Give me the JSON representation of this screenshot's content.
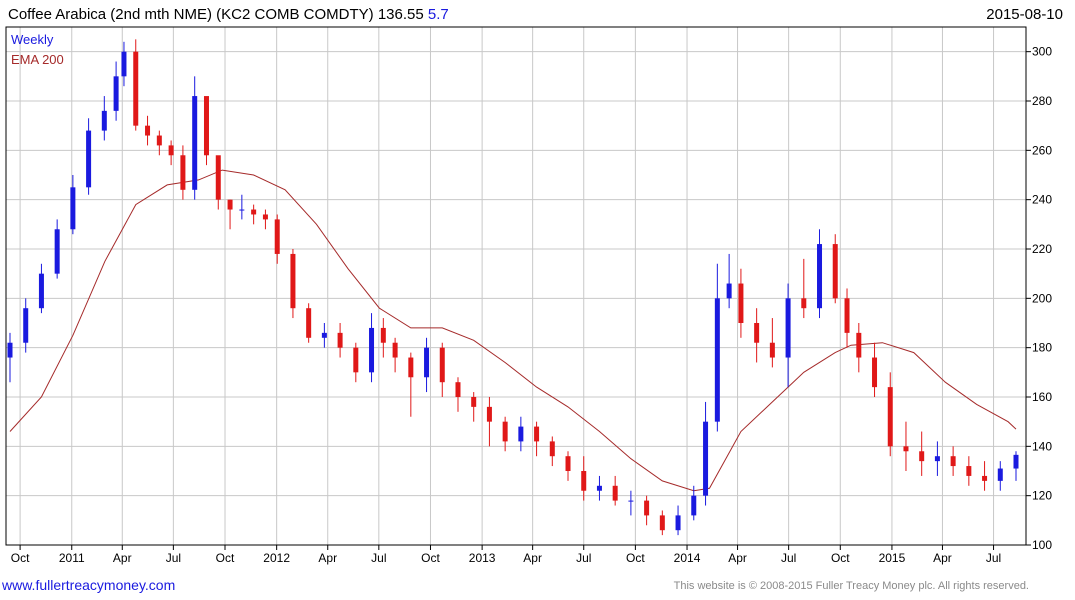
{
  "header": {
    "title": "Coffee Arabica (2nd mth NME) (KC2 COMB COMDTY) 136.55",
    "change": "5.7",
    "date": "2015-08-10"
  },
  "footer": {
    "link": "www.fullertreacymoney.com",
    "copyright": "This website is © 2008-2015 Fuller Treacy Money plc. All rights reserved."
  },
  "colors": {
    "up": "#1a1adf",
    "down": "#e01818",
    "ema": "#a52a2a",
    "grid": "#c8c8c8"
  },
  "chart_data": {
    "type": "line",
    "subtype": "weekly candlestick with moving average",
    "legend": [
      {
        "label": "Weekly",
        "color": "#1a1adf"
      },
      {
        "label": "EMA 200",
        "color": "#a52a2a"
      }
    ],
    "legend_position": "top-left",
    "grid": true,
    "yaxis_side": "right",
    "ylim": [
      100,
      310
    ],
    "yticks": [
      100,
      120,
      140,
      160,
      180,
      200,
      220,
      240,
      260,
      280,
      300
    ],
    "xlim": [
      "2010-09-13",
      "2015-08-10"
    ],
    "xticks": [
      {
        "label": "Oct",
        "date": "2010-10-01"
      },
      {
        "label": "2011",
        "date": "2011-01-01"
      },
      {
        "label": "Apr",
        "date": "2011-04-01"
      },
      {
        "label": "Jul",
        "date": "2011-07-01"
      },
      {
        "label": "Oct",
        "date": "2011-10-01"
      },
      {
        "label": "2012",
        "date": "2012-01-01"
      },
      {
        "label": "Apr",
        "date": "2012-04-01"
      },
      {
        "label": "Jul",
        "date": "2012-07-01"
      },
      {
        "label": "Oct",
        "date": "2012-10-01"
      },
      {
        "label": "2013",
        "date": "2013-01-01"
      },
      {
        "label": "Apr",
        "date": "2013-04-01"
      },
      {
        "label": "Jul",
        "date": "2013-07-01"
      },
      {
        "label": "Oct",
        "date": "2013-10-01"
      },
      {
        "label": "2014",
        "date": "2014-01-01"
      },
      {
        "label": "Apr",
        "date": "2014-04-01"
      },
      {
        "label": "Jul",
        "date": "2014-07-01"
      },
      {
        "label": "Oct",
        "date": "2014-10-01"
      },
      {
        "label": "2015",
        "date": "2015-01-01"
      },
      {
        "label": "Apr",
        "date": "2015-04-01"
      },
      {
        "label": "Jul",
        "date": "2015-07-01"
      }
    ],
    "series": [
      {
        "name": "Weekly",
        "style": "candlestick",
        "x": [
          "2010-09-13",
          "2010-10-11",
          "2010-11-08",
          "2010-12-06",
          "2011-01-03",
          "2011-01-31",
          "2011-02-28",
          "2011-03-21",
          "2011-04-04",
          "2011-04-25",
          "2011-05-16",
          "2011-06-06",
          "2011-06-27",
          "2011-07-18",
          "2011-08-08",
          "2011-08-29",
          "2011-09-19",
          "2011-10-10",
          "2011-10-31",
          "2011-11-21",
          "2011-12-12",
          "2012-01-02",
          "2012-01-30",
          "2012-02-27",
          "2012-03-26",
          "2012-04-23",
          "2012-05-21",
          "2012-06-18",
          "2012-07-09",
          "2012-07-30",
          "2012-08-27",
          "2012-09-24",
          "2012-10-22",
          "2012-11-19",
          "2012-12-17",
          "2013-01-14",
          "2013-02-11",
          "2013-03-11",
          "2013-04-08",
          "2013-05-06",
          "2013-06-03",
          "2013-07-01",
          "2013-07-29",
          "2013-08-26",
          "2013-09-23",
          "2013-10-21",
          "2013-11-18",
          "2013-12-16",
          "2014-01-13",
          "2014-02-03",
          "2014-02-24",
          "2014-03-17",
          "2014-04-07",
          "2014-05-05",
          "2014-06-02",
          "2014-06-30",
          "2014-07-28",
          "2014-08-25",
          "2014-09-22",
          "2014-10-13",
          "2014-11-03",
          "2014-12-01",
          "2014-12-29",
          "2015-01-26",
          "2015-02-23",
          "2015-03-23",
          "2015-04-20",
          "2015-05-18",
          "2015-06-15",
          "2015-07-13",
          "2015-08-10"
        ],
        "open": [
          176,
          182,
          196,
          210,
          228,
          245,
          268,
          276,
          290,
          300,
          270,
          266,
          262,
          258,
          244,
          282,
          258,
          240,
          236,
          236,
          234,
          232,
          218,
          196,
          184,
          186,
          180,
          170,
          188,
          182,
          176,
          168,
          180,
          166,
          160,
          156,
          150,
          142,
          148,
          142,
          136,
          130,
          122,
          124,
          118,
          118,
          112,
          106,
          112,
          120,
          150,
          200,
          206,
          190,
          182,
          176,
          200,
          196,
          222,
          200,
          186,
          176,
          164,
          140,
          138,
          134,
          136,
          132,
          128,
          126,
          131
        ],
        "close": [
          182,
          196,
          210,
          228,
          245,
          268,
          276,
          290,
          300,
          270,
          266,
          262,
          258,
          244,
          282,
          258,
          240,
          236,
          236,
          234,
          232,
          218,
          196,
          184,
          186,
          180,
          170,
          188,
          182,
          176,
          168,
          180,
          166,
          160,
          156,
          150,
          142,
          148,
          142,
          136,
          130,
          122,
          124,
          118,
          118,
          112,
          106,
          112,
          120,
          150,
          200,
          206,
          190,
          182,
          176,
          200,
          196,
          222,
          200,
          186,
          176,
          164,
          140,
          138,
          134,
          136,
          132,
          128,
          126,
          131,
          136.55
        ],
        "high": [
          186,
          200,
          214,
          232,
          250,
          273,
          282,
          296,
          304,
          305,
          274,
          268,
          264,
          262,
          290,
          262,
          244,
          240,
          242,
          238,
          236,
          234,
          220,
          198,
          190,
          190,
          182,
          194,
          192,
          184,
          178,
          184,
          182,
          168,
          162,
          160,
          152,
          152,
          150,
          144,
          138,
          136,
          128,
          128,
          122,
          120,
          114,
          116,
          124,
          158,
          214,
          218,
          212,
          196,
          192,
          206,
          216,
          228,
          226,
          204,
          190,
          182,
          170,
          150,
          146,
          142,
          140,
          136,
          134,
          134,
          138
        ],
        "low": [
          166,
          178,
          194,
          208,
          226,
          242,
          264,
          272,
          286,
          268,
          262,
          258,
          254,
          240,
          240,
          254,
          236,
          228,
          232,
          230,
          228,
          214,
          192,
          182,
          180,
          176,
          166,
          166,
          176,
          170,
          152,
          162,
          160,
          154,
          150,
          140,
          138,
          138,
          136,
          132,
          126,
          118,
          118,
          116,
          112,
          108,
          104,
          104,
          110,
          116,
          146,
          196,
          184,
          174,
          172,
          164,
          192,
          192,
          198,
          180,
          170,
          160,
          136,
          130,
          128,
          128,
          128,
          124,
          122,
          122,
          126
        ]
      },
      {
        "name": "EMA 200",
        "style": "line",
        "x": [
          "2010-09-13",
          "2010-11-08",
          "2011-01-03",
          "2011-03-01",
          "2011-04-25",
          "2011-06-20",
          "2011-08-15",
          "2011-09-26",
          "2011-11-21",
          "2012-01-16",
          "2012-03-12",
          "2012-05-07",
          "2012-07-02",
          "2012-08-27",
          "2012-10-22",
          "2012-12-17",
          "2013-02-11",
          "2013-04-08",
          "2013-06-03",
          "2013-07-29",
          "2013-09-23",
          "2013-11-18",
          "2014-01-13",
          "2014-02-10",
          "2014-04-07",
          "2014-06-02",
          "2014-07-28",
          "2014-09-22",
          "2014-10-20",
          "2014-12-15",
          "2015-02-09",
          "2015-04-06",
          "2015-06-01",
          "2015-07-27",
          "2015-08-10"
        ],
        "values": [
          146,
          160,
          185,
          215,
          238,
          246,
          248,
          252,
          250,
          244,
          230,
          212,
          196,
          188,
          188,
          183,
          174,
          164,
          156,
          146,
          135,
          126,
          122,
          123,
          146,
          158,
          170,
          178,
          181,
          182,
          178,
          166,
          157,
          150,
          147
        ]
      }
    ]
  }
}
